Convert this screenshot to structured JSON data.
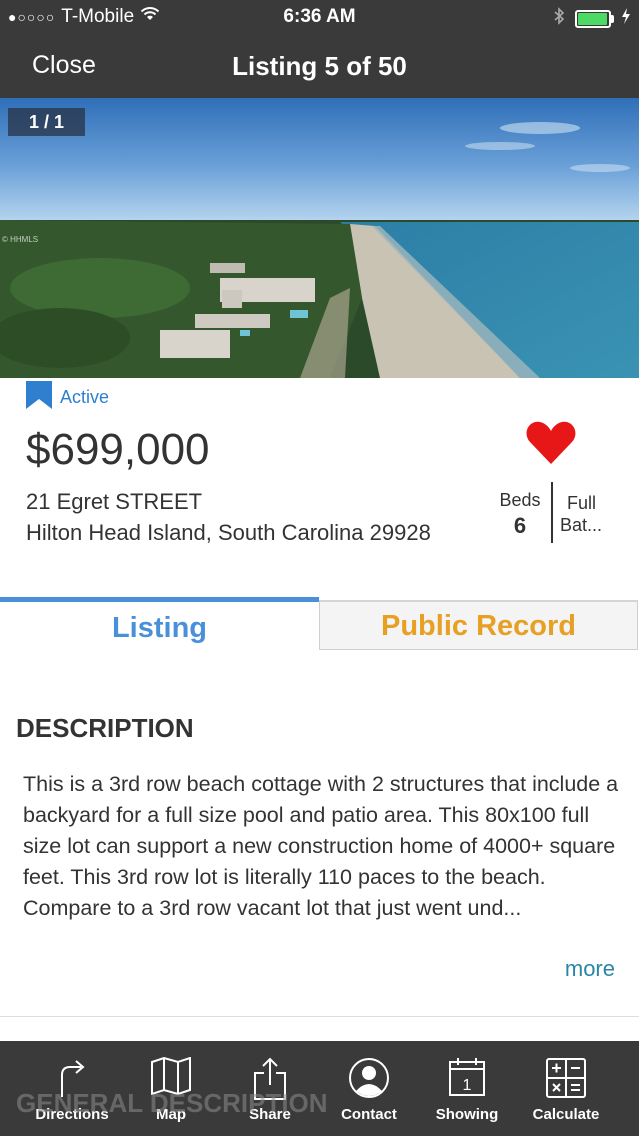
{
  "status_bar": {
    "signal_dots": "●○○○○",
    "carrier": "T-Mobile",
    "time": "6:36 AM",
    "battery_level": 0.9,
    "icons": [
      "wifi-icon",
      "bluetooth-icon",
      "battery-icon",
      "charging-icon"
    ]
  },
  "nav": {
    "close_label": "Close",
    "title": "Listing 5 of 50"
  },
  "photo": {
    "counter": "1 / 1",
    "watermark": "© HHMLS"
  },
  "listing": {
    "status": "Active",
    "price": "$699,000",
    "address_line1": "21 Egret STREET",
    "address_line2": "Hilton Head Island, South Carolina 29928",
    "beds_label": "Beds",
    "beds_value": "6",
    "baths_label_line1": "Full",
    "baths_label_line2": "Bat..."
  },
  "tabs": {
    "listing": "Listing",
    "public_record": "Public Record"
  },
  "description": {
    "title": "DESCRIPTION",
    "body": "This is a 3rd row beach cottage with 2 structures that include a backyard for a full size pool and patio area. This 80x100 full size lot can support a new construction home of 4000+ square feet. This 3rd row lot is literally 110 paces to the beach. Compare to a 3rd row vacant lot that just went und...",
    "more_label": "more"
  },
  "next_section_title": "GENERAL DESCRIPTION",
  "toolbar": {
    "items": [
      {
        "label": "Directions",
        "icon": "directions-icon"
      },
      {
        "label": "Map",
        "icon": "map-icon"
      },
      {
        "label": "Share",
        "icon": "share-icon"
      },
      {
        "label": "Contact",
        "icon": "contact-icon"
      },
      {
        "label": "Showing",
        "icon": "calendar-icon",
        "icon_text": "1"
      },
      {
        "label": "Calculate",
        "icon": "calculator-icon"
      }
    ]
  },
  "colors": {
    "bar_background": "#3a3a3a",
    "accent_blue": "#4a90d9",
    "public_record_orange": "#e8a024",
    "heart_red": "#e81717",
    "more_link": "#2a86a8"
  }
}
